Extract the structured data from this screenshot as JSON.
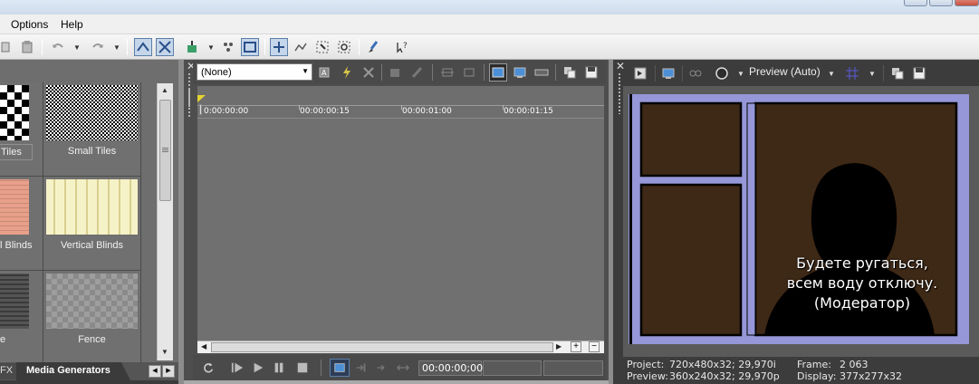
{
  "menu": {
    "items": [
      "Options",
      "Help"
    ]
  },
  "media_generators": {
    "tiles": [
      {
        "label": "Tiles"
      },
      {
        "label": "Small Tiles"
      },
      {
        "label": "l Blinds"
      },
      {
        "label": "Vertical Blinds"
      },
      {
        "label": "e"
      },
      {
        "label": "Fence"
      }
    ],
    "tabs": [
      "FX",
      "Media Generators"
    ]
  },
  "trimmer": {
    "select_value": "(None)",
    "ruler_ticks": [
      "0:00:00:00",
      "00:00:00:15",
      "00:00:01:00",
      "00:00:01:15"
    ],
    "timecode": "00:00:00;00"
  },
  "preview": {
    "quality_label": "Preview (Auto)",
    "subtitle_lines": [
      "Будете ругаться,",
      "всем воду отключу.",
      "(Модератор)"
    ],
    "info": {
      "project_label": "Project:",
      "project_value": "720x480x32; 29,970i",
      "preview_label": "Preview:",
      "preview_value": "360x240x32; 29,970p",
      "frame_label": "Frame:",
      "frame_value": "2 063",
      "display_label": "Display:",
      "display_value": "377x277x32"
    }
  },
  "colors": {
    "panel_dark": "#3b3b3b",
    "frame_border": "#9597d8",
    "window_interior": "#3e2816"
  }
}
